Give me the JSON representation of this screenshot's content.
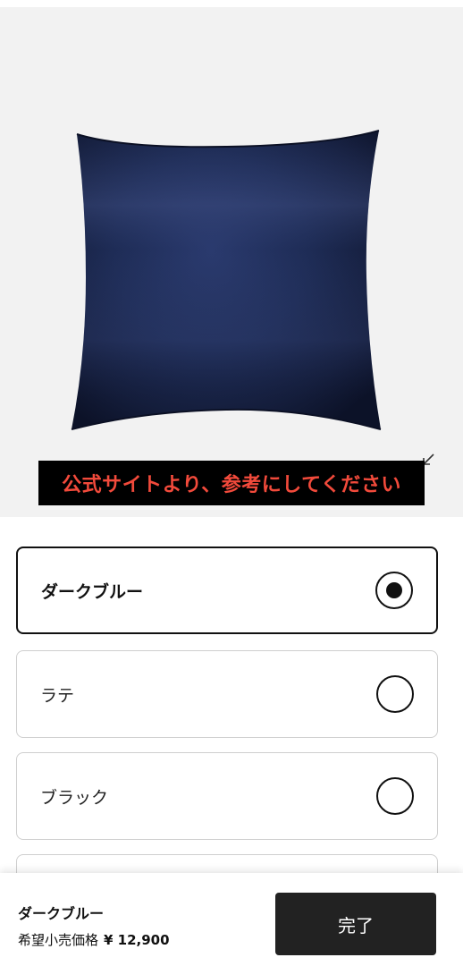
{
  "product_image": {
    "alt": "ダークブルー",
    "notice": "公式サイトより、参考にしてください",
    "expand_icon": "expand-arrow-icon"
  },
  "options": [
    {
      "label": "ダークブルー",
      "selected": true
    },
    {
      "label": "ラテ",
      "selected": false
    },
    {
      "label": "ブラック",
      "selected": false
    },
    {
      "label": "",
      "selected": false
    }
  ],
  "summary": {
    "name": "ダークブルー",
    "price_label": "希望小売価格",
    "price_value": "¥ 12,900"
  },
  "done_button": {
    "label": "完了"
  },
  "colors": {
    "pillow": "#1c2a52",
    "notice_text": "#f24a3b",
    "button_bg": "#222222"
  }
}
